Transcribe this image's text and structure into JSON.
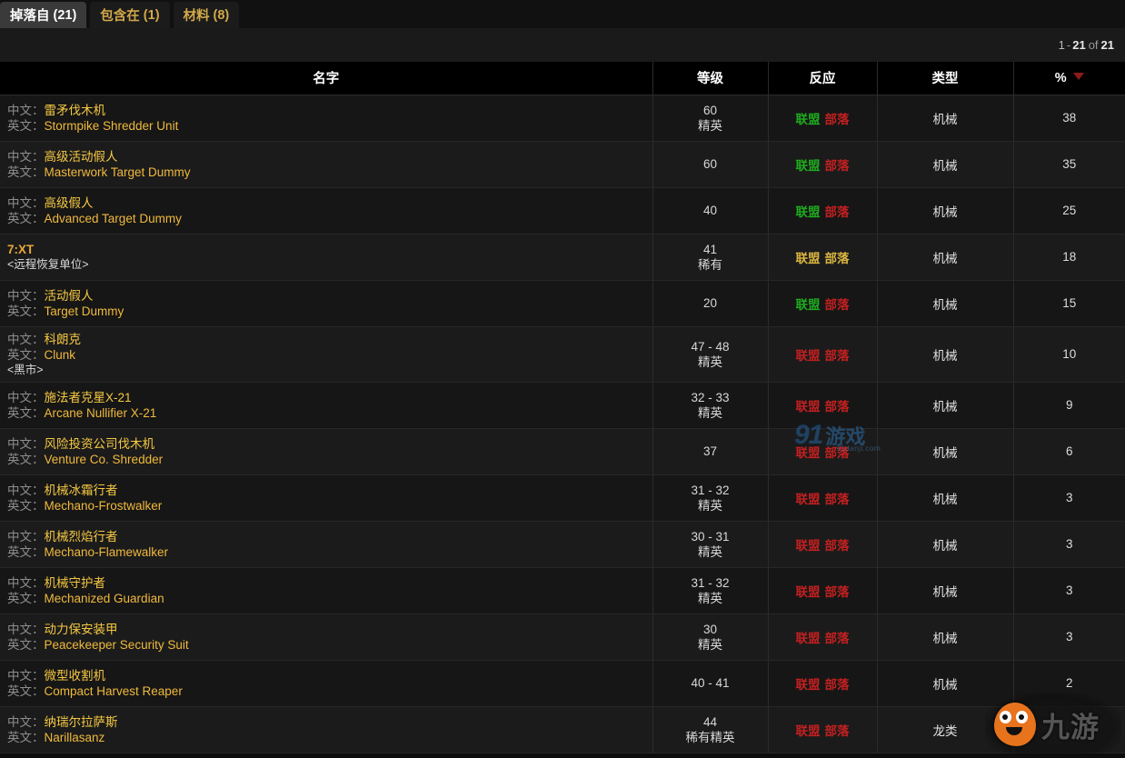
{
  "tabs": [
    {
      "label": "掉落自",
      "count": "(21)",
      "active": true
    },
    {
      "label": "包含在",
      "count": "(1)",
      "active": false
    },
    {
      "label": "材料",
      "count": "(8)",
      "active": false
    }
  ],
  "pager": {
    "from": "1",
    "dash": "-",
    "to": "21",
    "of": "of",
    "total": "21"
  },
  "columns": {
    "name": "名字",
    "level": "等级",
    "reaction": "反应",
    "type": "类型",
    "percent": "%",
    "sort_icon": "sort-descending-triangle"
  },
  "labels": {
    "cn": "中文：",
    "en": "英文："
  },
  "factions": {
    "alliance": "联盟",
    "horde": "部落"
  },
  "colors": {
    "accent_gold": "#f5c842",
    "alliance_green": "#1faa1f",
    "horde_red": "#c22020",
    "neutral_yellow": "#d9b440",
    "tab_active_bg": "#3a3a3a",
    "tab_text": "#d2a94a",
    "sort_arrow": "#8e1b1b"
  },
  "watermarks": {
    "center": {
      "brand": "91",
      "suffix": "游戏",
      "url": "91danji.com"
    },
    "corner": {
      "brand": "九游"
    }
  },
  "rows": [
    {
      "name_cn": "雷矛伐木机",
      "name_en": "Stormpike Shredder Unit",
      "level": "60",
      "level_rank": "精英",
      "alliance_color": "green",
      "horde_color": "red",
      "type": "机械",
      "percent": "38"
    },
    {
      "name_cn": "高级活动假人",
      "name_en": "Masterwork Target Dummy",
      "level": "60",
      "level_rank": "",
      "alliance_color": "green",
      "horde_color": "red",
      "type": "机械",
      "percent": "35"
    },
    {
      "name_cn": "高级假人",
      "name_en": "Advanced Target Dummy",
      "level": "40",
      "level_rank": "",
      "alliance_color": "green",
      "horde_color": "red",
      "type": "机械",
      "percent": "25"
    },
    {
      "single_name": "7:XT",
      "subtitle": "<远程恢复单位>",
      "level": "41",
      "level_rank": "稀有",
      "alliance_color": "yellow",
      "horde_color": "yellow",
      "type": "机械",
      "percent": "18"
    },
    {
      "name_cn": "活动假人",
      "name_en": "Target Dummy",
      "level": "20",
      "level_rank": "",
      "alliance_color": "green",
      "horde_color": "red",
      "type": "机械",
      "percent": "15"
    },
    {
      "name_cn": "科朗克",
      "name_en": "Clunk",
      "subtitle": "<黑市>",
      "level": "47 - 48",
      "level_rank": "精英",
      "alliance_color": "red",
      "horde_color": "red",
      "type": "机械",
      "percent": "10"
    },
    {
      "name_cn": "施法者克星X-21",
      "name_en": "Arcane Nullifier X-21",
      "level": "32 - 33",
      "level_rank": "精英",
      "alliance_color": "red",
      "horde_color": "red",
      "type": "机械",
      "percent": "9"
    },
    {
      "name_cn": "风险投资公司伐木机",
      "name_en": "Venture Co. Shredder",
      "level": "37",
      "level_rank": "",
      "alliance_color": "red",
      "horde_color": "red",
      "type": "机械",
      "percent": "6"
    },
    {
      "name_cn": "机械冰霜行者",
      "name_en": "Mechano-Frostwalker",
      "level": "31 - 32",
      "level_rank": "精英",
      "alliance_color": "red",
      "horde_color": "red",
      "type": "机械",
      "percent": "3"
    },
    {
      "name_cn": "机械烈焰行者",
      "name_en": "Mechano-Flamewalker",
      "level": "30 - 31",
      "level_rank": "精英",
      "alliance_color": "red",
      "horde_color": "red",
      "type": "机械",
      "percent": "3"
    },
    {
      "name_cn": "机械守护者",
      "name_en": "Mechanized Guardian",
      "level": "31 - 32",
      "level_rank": "精英",
      "alliance_color": "red",
      "horde_color": "red",
      "type": "机械",
      "percent": "3"
    },
    {
      "name_cn": "动力保安装甲",
      "name_en": "Peacekeeper Security Suit",
      "level": "30",
      "level_rank": "精英",
      "alliance_color": "red",
      "horde_color": "red",
      "type": "机械",
      "percent": "3"
    },
    {
      "name_cn": "微型收割机",
      "name_en": "Compact Harvest Reaper",
      "level": "40 - 41",
      "level_rank": "",
      "alliance_color": "red",
      "horde_color": "red",
      "type": "机械",
      "percent": "2"
    },
    {
      "name_cn": "纳瑞尔拉萨斯",
      "name_en": "Narillasanz",
      "level": "44",
      "level_rank": "稀有精英",
      "alliance_color": "red",
      "horde_color": "red",
      "type": "龙类",
      "percent": ""
    }
  ]
}
